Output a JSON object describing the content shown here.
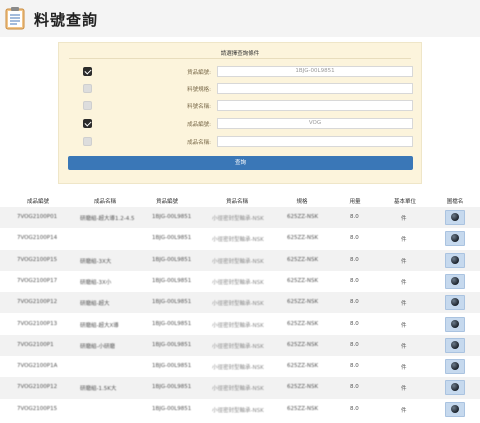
{
  "page": {
    "title": "料號查詢"
  },
  "colors": {
    "accent": "#3a77b7",
    "panel_bg": "#fcf4dc",
    "header_bg": "#f4f4f4"
  },
  "search_panel": {
    "title": "請選擇查詢條件",
    "fields": [
      {
        "checked": true,
        "label": "貨品編號:",
        "value": "1BJG-00L9851"
      },
      {
        "checked": false,
        "label": "料號規格:",
        "value": ""
      },
      {
        "checked": false,
        "label": "料號名稱:",
        "value": ""
      },
      {
        "checked": true,
        "label": "成品編號:",
        "value": "VOG"
      },
      {
        "checked": false,
        "label": "成品名稱:",
        "value": ""
      }
    ],
    "query_button": "查詢"
  },
  "table": {
    "headers": [
      "成品編號",
      "成品名稱",
      "貨品編號",
      "貨品名稱",
      "規格",
      "用量",
      "基本單位",
      "圖檔名"
    ],
    "rows": [
      [
        "7VOG2100P01",
        "研磨組-超大導1.2-4.5",
        "1BJG-00L9851",
        "小徑密封型軸承-NSK",
        "625ZZ-NSK",
        "8.0",
        "件"
      ],
      [
        "7VOG2100P14",
        "",
        "1BJG-00L9851",
        "小徑密封型軸承-NSK",
        "625ZZ-NSK",
        "8.0",
        "件"
      ],
      [
        "7VOG2100P15",
        "研磨組-3X大",
        "1BJG-00L9851",
        "小徑密封型軸承-NSK",
        "625ZZ-NSK",
        "8.0",
        "件"
      ],
      [
        "7VOG2100P17",
        "研磨組-3X小",
        "1BJG-00L9851",
        "小徑密封型軸承-NSK",
        "625ZZ-NSK",
        "8.0",
        "件"
      ],
      [
        "7VOG2100P12",
        "研磨組-超大",
        "1BJG-00L9851",
        "小徑密封型軸承-NSK",
        "625ZZ-NSK",
        "8.0",
        "件"
      ],
      [
        "7VOG2100P13",
        "研磨組-超大X導",
        "1BJG-00L9851",
        "小徑密封型軸承-NSK",
        "625ZZ-NSK",
        "8.0",
        "件"
      ],
      [
        "7VOG2100P1",
        "研磨組-小研磨",
        "1BJG-00L9851",
        "小徑密封型軸承-NSK",
        "625ZZ-NSK",
        "8.0",
        "件"
      ],
      [
        "7VOG2100P1A",
        "",
        "1BJG-00L9851",
        "小徑密封型軸承-NSK",
        "625ZZ-NSK",
        "8.0",
        "件"
      ],
      [
        "7VOG2100P12",
        "研磨組-1.5K大",
        "1BJG-00L9851",
        "小徑密封型軸承-NSK",
        "625ZZ-NSK",
        "8.0",
        "件"
      ],
      [
        "7VOG2100P15",
        "",
        "1BJG-00L9851",
        "小徑密封型軸承-NSK",
        "625ZZ-NSK",
        "8.0",
        "件"
      ]
    ]
  }
}
